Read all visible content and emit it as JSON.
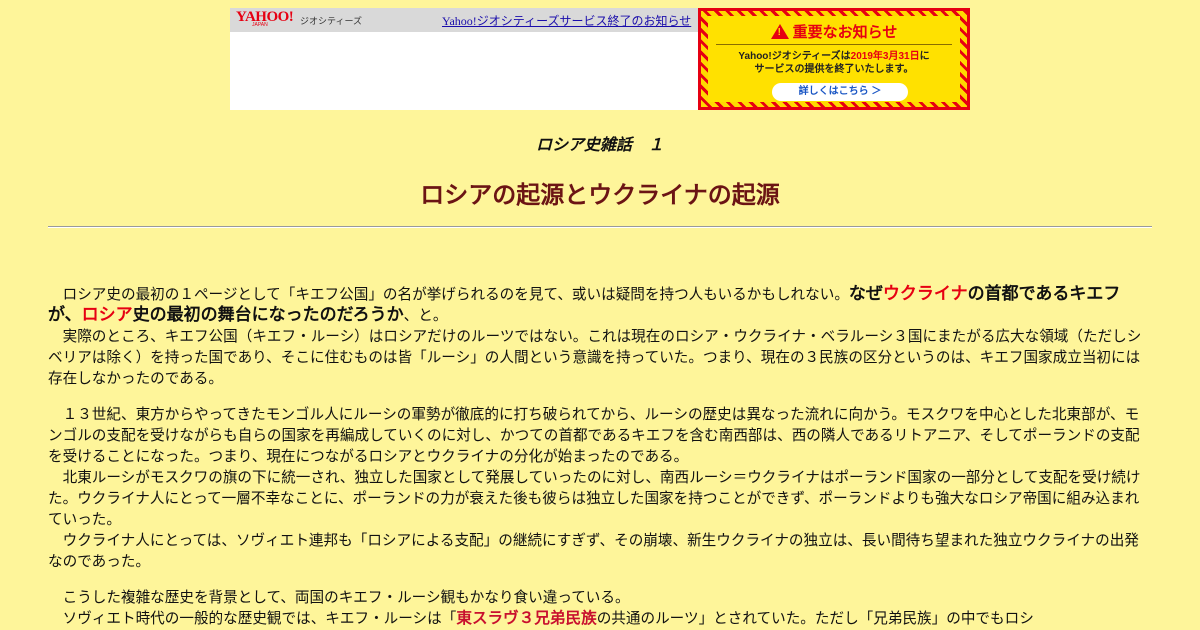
{
  "banner": {
    "logo_text": "YAHOO!",
    "logo_sub": "JAPAN",
    "service_name": "ジオシティーズ",
    "notice_link": "Yahoo!ジオシティーズサービス終了のお知らせ",
    "important_title": "重要なお知らせ",
    "important_line1_a": "Yahoo!ジオシティーズは",
    "important_line1_date": "2019年3月31日",
    "important_line1_b": "に",
    "important_line2": "サービスの提供を終了いたします。",
    "details_button": "詳しくはこちら ＞",
    "colors": {
      "red": "#e60012",
      "yellow": "#ffe100",
      "link": "#1a0dab"
    }
  },
  "header": {
    "series": "ロシア史雑話　１",
    "title": "ロシアの起源とウクライナの起源"
  },
  "body": {
    "p1_a": "　ロシア史の最初の１ページとして「キエフ公国」の名が挙げられるのを見て、或いは疑問を持つ人もいるかもしれない。",
    "p1_em1": "なぜ",
    "p1_em_red1": "ウクライナ",
    "p1_em2": "の首都であるキエフが、",
    "p1_em_red2": "ロシア",
    "p1_em3": "史の最初の舞台になったのだろうか",
    "p1_end": "、と。",
    "p2": "　実際のところ、キエフ公国（キエフ・ルーシ）はロシアだけのルーツではない。これは現在のロシア・ウクライナ・ベラルーシ３国にまたがる広大な領域（ただしシベリアは除く）を持った国であり、そこに住むものは皆「ルーシ」の人間という意識を持っていた。つまり、現在の３民族の区分というのは、キエフ国家成立当初には存在しなかったのである。",
    "p3": "　１３世紀、東方からやってきたモンゴル人にルーシの軍勢が徹底的に打ち破られてから、ルーシの歴史は異なった流れに向かう。モスクワを中心とした北東部が、モンゴルの支配を受けながらも自らの国家を再編成していくのに対し、かつての首都であるキエフを含む南西部は、西の隣人であるリトアニア、そしてポーランドの支配を受けることになった。つまり、現在につながるロシアとウクライナの分化が始まったのである。",
    "p4": "　北東ルーシがモスクワの旗の下に統一され、独立した国家として発展していったのに対し、南西ルーシ＝ウクライナはポーランド国家の一部分として支配を受け続けた。ウクライナ人にとって一層不幸なことに、ポーランドの力が衰えた後も彼らは独立した国家を持つことができず、ポーランドよりも強大なロシア帝国に組み込まれていった。",
    "p5": "　ウクライナ人にとっては、ソヴィエト連邦も「ロシアによる支配」の継続にすぎず、その崩壊、新生ウクライナの独立は、長い間待ち望まれた独立ウクライナの出発なのであった。",
    "p6": "　こうした複雑な歴史を背景として、両国のキエフ・ルーシ観もかなり食い違っている。",
    "p7_a": "　ソヴィエト時代の一般的な歴史観では、キエフ・ルーシは「",
    "p7_hl": "東スラヴ３兄弟民族",
    "p7_b": "の共通のルーツ」とされていた。ただし「兄弟民族」の中でもロシ"
  }
}
